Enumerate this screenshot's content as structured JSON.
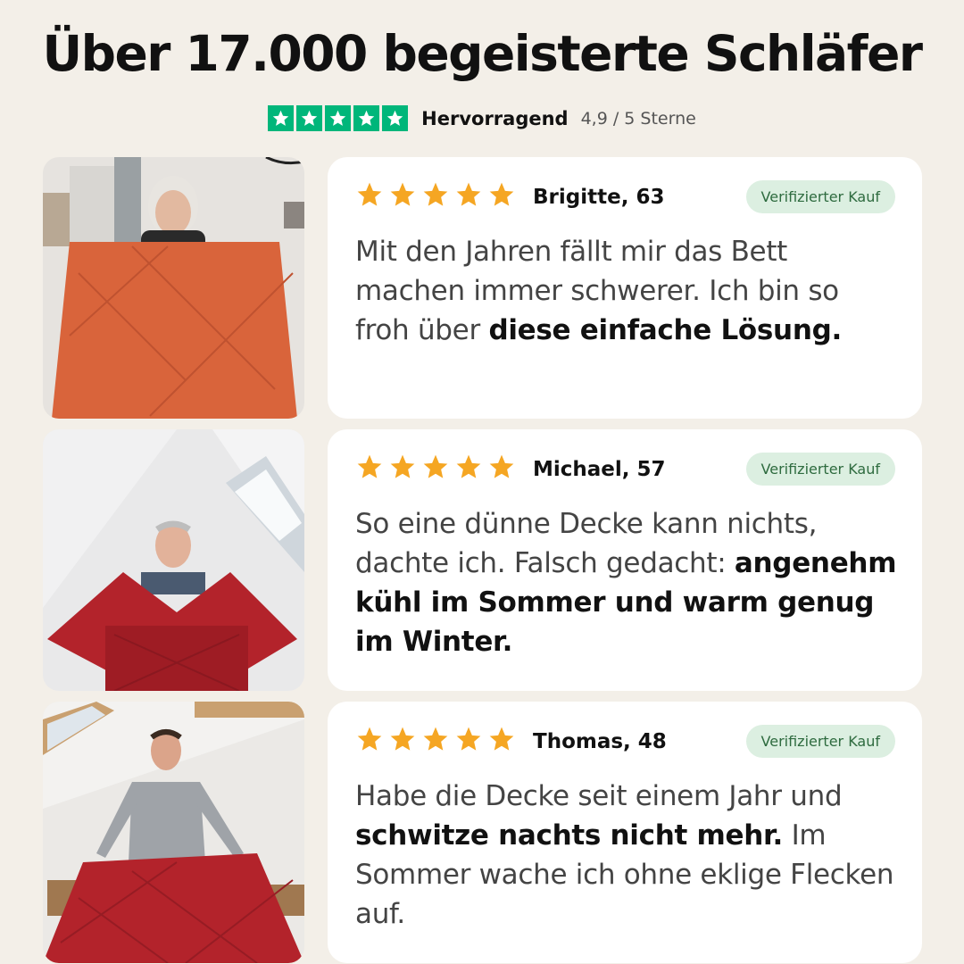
{
  "headline": "Über 17.000 begeisterte Schläfer",
  "rating": {
    "stars": 5,
    "label": "Hervorragend",
    "score": "4,9 / 5 Sterne",
    "color": "#00b67a"
  },
  "reviews": [
    {
      "stars": 5,
      "name": "Brigitte, 63",
      "badge": "Verifizierter Kauf",
      "text_pre": "Mit den Jahren fällt mir das Bett machen immer schwerer. Ich bin so froh über ",
      "text_bold": "diese einfache Lösung.",
      "text_post": "",
      "blanket_color": "#d9643b"
    },
    {
      "stars": 5,
      "name": "Michael, 57",
      "badge": "Verifizierter Kauf",
      "text_pre": "So eine dünne Decke kann nichts, dachte ich. Falsch gedacht: ",
      "text_bold": "angenehm kühl im Sommer und warm genug im Winter.",
      "text_post": "",
      "blanket_color": "#b3232b"
    },
    {
      "stars": 5,
      "name": "Thomas, 48",
      "badge": "Verifizierter Kauf",
      "text_pre": "Habe die Decke seit einem Jahr und ",
      "text_bold": "schwitze nachts nicht mehr.",
      "text_post": " Im Sommer wache ich ohne eklige Flecken auf.",
      "blanket_color": "#b3232b"
    }
  ],
  "colors": {
    "background": "#f3efe8",
    "star": "#f5a623",
    "badge_bg": "#dcefe1",
    "badge_text": "#2e6b3f"
  }
}
